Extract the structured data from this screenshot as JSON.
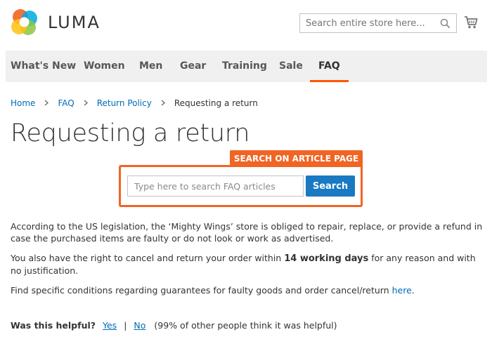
{
  "header": {
    "logo_text": "LUMA",
    "search_placeholder": "Search entire store here...",
    "search_icon": "search-icon",
    "cart_icon": "shopping-cart-icon"
  },
  "nav": {
    "items": [
      {
        "label": "What's New",
        "active": false
      },
      {
        "label": "Women",
        "active": false
      },
      {
        "label": "Men",
        "active": false
      },
      {
        "label": "Gear",
        "active": false
      },
      {
        "label": "Training",
        "active": false
      },
      {
        "label": "Sale",
        "active": false
      },
      {
        "label": "FAQ",
        "active": true
      }
    ],
    "accent_color": "#ff5501"
  },
  "breadcrumb": {
    "items": [
      {
        "label": "Home"
      },
      {
        "label": "FAQ"
      },
      {
        "label": "Return Policy"
      }
    ],
    "current": "Requesting a return"
  },
  "page": {
    "title": "Requesting a return"
  },
  "article_search": {
    "tab_label": "SEARCH ON ARTICLE  PAGE",
    "placeholder": "Type here to search FAQ articles",
    "button_label": "Search",
    "border_color": "#f06424",
    "button_color": "#1979c3"
  },
  "article": {
    "p1": "According to the US legislation, the ‘Mighty Wings’ store is obliged to repair, replace, or provide a refund in case the purchased items are faulty or do not look or work as advertised.",
    "p2_before": "You also have the right to cancel and return your order within ",
    "p2_bold": "14 working days",
    "p2_after": " for any reason and with no justification.",
    "p3_before": "Find specific conditions regarding guarantees for faulty goods and order cancel/return ",
    "p3_link": "here",
    "p3_after": "."
  },
  "helpful": {
    "label": "Was this helpful?",
    "yes": "Yes",
    "separator": "|",
    "no": "No",
    "stats": "(99% of other people think it was helpful)"
  }
}
